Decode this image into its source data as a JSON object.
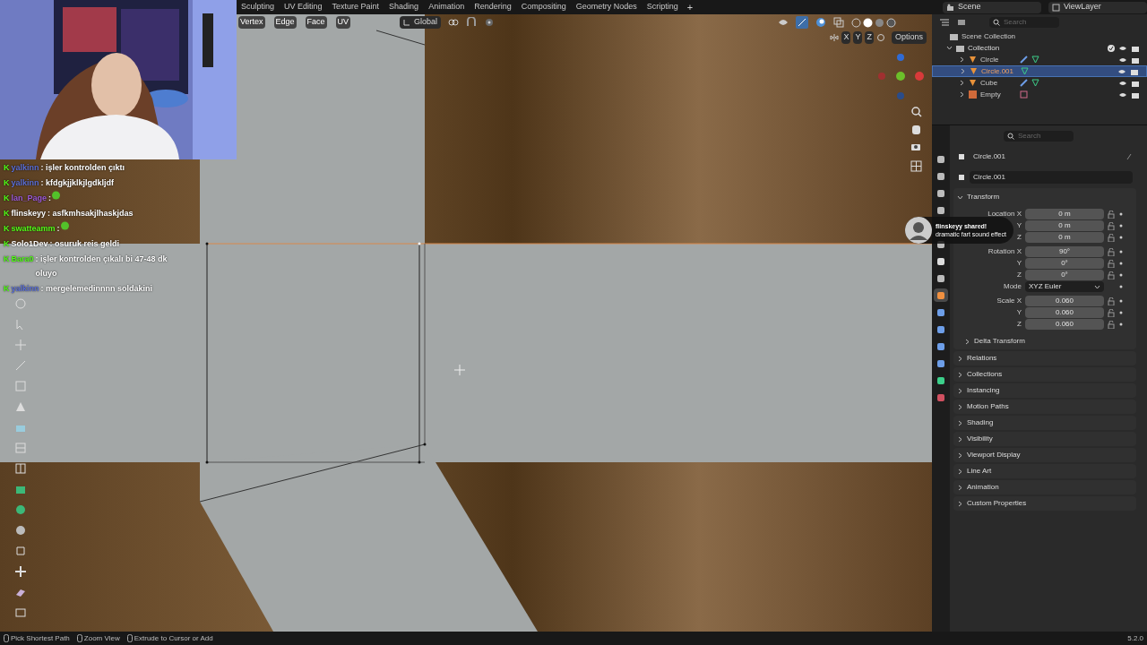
{
  "workspace_tabs": [
    {
      "label": "Sculpting",
      "selected": false
    },
    {
      "label": "UV Editing",
      "selected": false
    },
    {
      "label": "Texture Paint",
      "selected": false
    },
    {
      "label": "Shading",
      "selected": false
    },
    {
      "label": "Animation",
      "selected": false
    },
    {
      "label": "Rendering",
      "selected": false
    },
    {
      "label": "Compositing",
      "selected": false
    },
    {
      "label": "Geometry Nodes",
      "selected": false
    },
    {
      "label": "Scripting",
      "selected": false
    }
  ],
  "add_tab": "+",
  "scene": "Scene",
  "view_layer": "ViewLayer",
  "viewport_header": {
    "menus": [
      "Vertex",
      "Edge",
      "Face",
      "UV"
    ],
    "orientation": "Global",
    "axes": [
      "X",
      "Y",
      "Z"
    ],
    "options": "Options"
  },
  "outliner": {
    "search_placeholder": "Search",
    "root": "Scene Collection",
    "collection": {
      "label": "Collection",
      "expanded": true,
      "checked": true,
      "children": [
        {
          "label": "Circle",
          "kind": "mesh",
          "selected": false,
          "expanded": false,
          "modifier": true
        },
        {
          "label": "Circle.001",
          "kind": "mesh",
          "selected": true,
          "expanded": false,
          "modifier": false
        },
        {
          "label": "Cube",
          "kind": "mesh",
          "selected": false,
          "expanded": false,
          "modifier": true
        },
        {
          "label": "Empty",
          "kind": "empty",
          "selected": false,
          "expanded": false,
          "modifier": false
        }
      ]
    }
  },
  "property_tabs": [
    {
      "selected": false
    },
    {
      "selected": false
    },
    {
      "selected": false
    },
    {
      "selected": false
    },
    {
      "selected": false
    },
    {
      "selected": false
    },
    {
      "selected": false
    },
    {
      "selected": true
    },
    {
      "selected": false
    },
    {
      "selected": false
    },
    {
      "selected": false
    },
    {
      "selected": false
    },
    {
      "selected": false
    },
    {
      "selected": false
    }
  ],
  "properties": {
    "search_placeholder": "Search",
    "object_name": "Circle.001",
    "data_name": "Circle.001",
    "transform": {
      "title": "Transform",
      "expanded": true,
      "rows": [
        {
          "kind": "field",
          "label": "Location X",
          "value": "0 m"
        },
        {
          "kind": "field",
          "label": "Y",
          "value": "0 m"
        },
        {
          "kind": "field",
          "label": "Z",
          "value": "0 m"
        },
        {
          "kind": "field",
          "label": "Rotation X",
          "value": "90°"
        },
        {
          "kind": "field",
          "label": "Y",
          "value": "0°"
        },
        {
          "kind": "field",
          "label": "Z",
          "value": "0°"
        },
        {
          "kind": "dropdown",
          "label": "Mode",
          "value": "XYZ Euler"
        },
        {
          "kind": "field",
          "label": "Scale X",
          "value": "0.060"
        },
        {
          "kind": "field",
          "label": "Y",
          "value": "0.060"
        },
        {
          "kind": "field",
          "label": "Z",
          "value": "0.060"
        }
      ],
      "subpanel": {
        "title": "Delta Transform",
        "expanded": false
      }
    },
    "panels": [
      {
        "title": "Relations",
        "expanded": false
      },
      {
        "title": "Collections",
        "expanded": false
      },
      {
        "title": "Instancing",
        "expanded": false
      },
      {
        "title": "Motion Paths",
        "expanded": false
      },
      {
        "title": "Shading",
        "expanded": false
      },
      {
        "title": "Visibility",
        "expanded": false
      },
      {
        "title": "Viewport Display",
        "expanded": false
      },
      {
        "title": "Line Art",
        "expanded": false
      },
      {
        "title": "Animation",
        "expanded": false
      },
      {
        "title": "Custom Properties",
        "expanded": false
      }
    ]
  },
  "chat": [
    {
      "badge": "K",
      "user": "yalkinn",
      "color": "#5b6fd6",
      "kind": "text",
      "text": ": işler kontrolden çıktı"
    },
    {
      "badge": "K",
      "user": "yalkinn",
      "color": "#5b6fd6",
      "kind": "text",
      "text": ": kfdgkjjklkjlgdkljdf"
    },
    {
      "badge": "K",
      "user": "lan_Page",
      "color": "#9b59d6",
      "kind": "emote",
      "text": ":"
    },
    {
      "badge": "K",
      "user": "flinskeyy",
      "color": "#ffffff",
      "kind": "text",
      "text": ": asfkmhsakjlhaskjdas"
    },
    {
      "badge": "K",
      "user": "swatteamm",
      "color": "#53fc18",
      "kind": "emote",
      "text": ":"
    },
    {
      "badge": "K",
      "user": "Solo1Dev",
      "color": "#ffffff",
      "kind": "text",
      "text": ": osuruk reis geldi"
    },
    {
      "badge": "K",
      "user": "Bara0",
      "color": "#53fc18",
      "kind": "text",
      "text": ": işler kontrolden çıkalı bi 47-48 dk oluyo"
    },
    {
      "badge": "K",
      "user": "yalkinn",
      "color": "#5b6fd6",
      "kind": "text",
      "text": ": mergelemedinnnn soldakini"
    }
  ],
  "alert": {
    "title": "flinskeyy shared!",
    "subtitle": "dramatic fart sound effect"
  },
  "status_bar": {
    "hints": [
      "Pick Shortest Path",
      "Zoom View",
      "Extrude to Cursor or Add"
    ],
    "version": "5.2.0"
  }
}
